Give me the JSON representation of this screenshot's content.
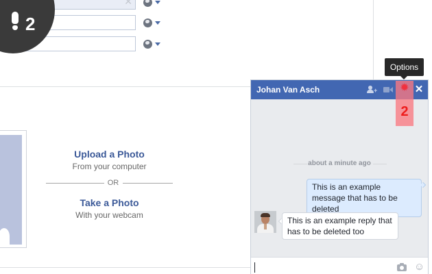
{
  "tutorial": {
    "step_number": "2",
    "highlight_number": "2"
  },
  "profile_fields": [
    {
      "value": "",
      "clear_icon": "clear-icon",
      "privacy_icon": "globe-icon"
    },
    {
      "value": "",
      "privacy_icon": "globe-icon"
    },
    {
      "value": "",
      "privacy_icon": "globe-icon"
    }
  ],
  "photo_panel": {
    "upload_title": "Upload a Photo",
    "upload_subtitle": "From your computer",
    "divider_text": "OR",
    "take_title": "Take a Photo",
    "take_subtitle": "With your webcam"
  },
  "tooltip": {
    "text": "Options"
  },
  "chat": {
    "contact_name": "Johan Van Asch",
    "header_icons": [
      "add-user-icon",
      "video-call-icon",
      "gear-icon",
      "close-icon"
    ],
    "timestamp": "about a minute ago",
    "messages": [
      {
        "direction": "outgoing",
        "text": "This is an example message that has to be deleted"
      },
      {
        "direction": "incoming",
        "text": "This is an example reply that has to be deleted too"
      }
    ],
    "composer": {
      "value": "",
      "icons": [
        "camera-icon",
        "smiley-icon"
      ]
    }
  },
  "colors": {
    "brand": "#4267b2",
    "highlight": "#f0313f",
    "badge": "#3a3a3a"
  }
}
